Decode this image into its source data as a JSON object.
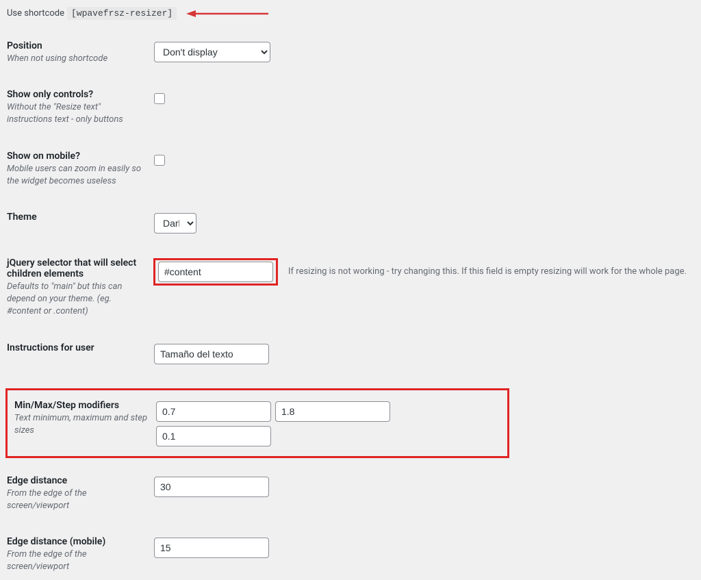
{
  "shortcode": {
    "label": "Use shortcode",
    "code": "[wpavefrsz-resizer]"
  },
  "fields": {
    "position": {
      "label": "Position",
      "desc": "When not using shortcode",
      "value": "Don't display"
    },
    "show_only_controls": {
      "label": "Show only controls?",
      "desc": "Without the \"Resize text\" instructions text - only buttons"
    },
    "show_on_mobile": {
      "label": "Show on mobile?",
      "desc": "Mobile users can zoom in easily so the widget becomes useless"
    },
    "theme": {
      "label": "Theme",
      "value": "Dark"
    },
    "selector": {
      "label": "jQuery selector that will select children elements",
      "desc": "Defaults to \"main\" but this can depend on your theme. (eg. #content or .content)",
      "value": "#content",
      "help": "If resizing is not working - try changing this. If this field is empty resizing will work for the whole page."
    },
    "instructions": {
      "label": "Instructions for user",
      "value": "Tamaño del texto"
    },
    "minmaxstep": {
      "label": "Min/Max/Step modifiers",
      "desc": "Text minimum, maximum and step sizes",
      "min": "0.7",
      "max": "1.8",
      "step": "0.1"
    },
    "edge": {
      "label": "Edge distance",
      "desc": "From the edge of the screen/viewport",
      "value": "30"
    },
    "edge_mobile": {
      "label": "Edge distance (mobile)",
      "desc": "From the edge of the screen/viewport",
      "value": "15"
    }
  }
}
